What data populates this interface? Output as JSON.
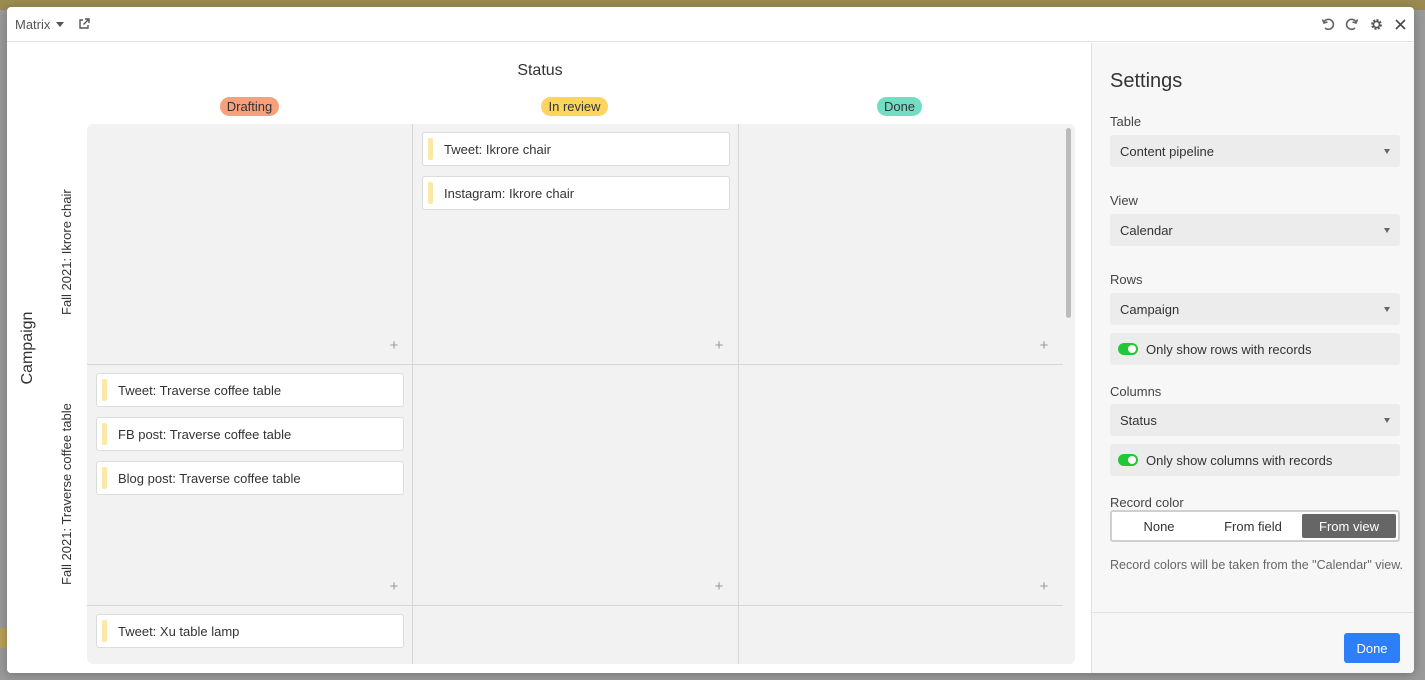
{
  "header": {
    "title": "Matrix"
  },
  "matrix": {
    "columns_field": "Status",
    "rows_field": "Campaign",
    "columns": [
      {
        "label": "Drafting",
        "color": "#f7a07c"
      },
      {
        "label": "In review",
        "color": "#fcd55f"
      },
      {
        "label": "Done",
        "color": "#72ddc3"
      }
    ],
    "rows": [
      {
        "label": "Fall 2021: Ikrore chair"
      },
      {
        "label": "Fall 2021: Traverse coffee table"
      }
    ],
    "cards": {
      "r0c1": [
        "Tweet: Ikrore chair",
        "Instagram: Ikrore chair"
      ],
      "r1c0": [
        "Tweet: Traverse coffee table",
        "FB post: Traverse coffee table",
        "Blog post: Traverse coffee table"
      ],
      "r2c0": [
        "Tweet: Xu table lamp"
      ]
    },
    "add_symbol": "+"
  },
  "settings": {
    "title": "Settings",
    "table_label": "Table",
    "table_value": "Content pipeline",
    "view_label": "View",
    "view_value": "Calendar",
    "rows_label": "Rows",
    "rows_value": "Campaign",
    "rows_toggle": "Only show rows with records",
    "columns_label": "Columns",
    "columns_value": "Status",
    "columns_toggle": "Only show columns with records",
    "record_color_label": "Record color",
    "record_color_options": [
      "None",
      "From field",
      "From view"
    ],
    "record_color_selected": "From view",
    "note": "Record colors will be taken from the \"Calendar\" view.",
    "done_label": "Done"
  },
  "colors": {
    "accent": "#2d7ff9",
    "toggle_on": "#20c933",
    "card_bar": "#fce8a6"
  }
}
